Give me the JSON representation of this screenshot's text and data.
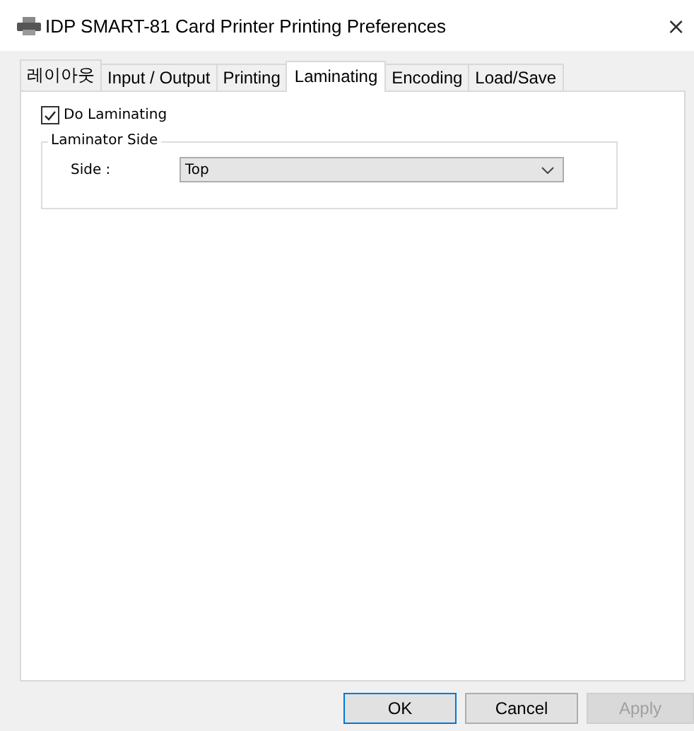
{
  "window": {
    "title": "IDP SMART-81 Card Printer Printing Preferences",
    "close": "×"
  },
  "tabs": [
    {
      "label": "레이아웃",
      "selected": false
    },
    {
      "label": "Input / Output",
      "selected": false
    },
    {
      "label": "Printing",
      "selected": false
    },
    {
      "label": "Laminating",
      "selected": true
    },
    {
      "label": "Encoding",
      "selected": false
    },
    {
      "label": "Load/Save",
      "selected": false
    }
  ],
  "do_laminating": {
    "label": "Do Laminating",
    "checked": true
  },
  "laminator_side": {
    "title": "Laminator Side",
    "label": "Side :",
    "value": "Top"
  },
  "buttons": [
    {
      "label": "OK",
      "default": true,
      "disabled": false
    },
    {
      "label": "Cancel",
      "default": false,
      "disabled": false
    },
    {
      "label": "Apply",
      "default": false,
      "disabled": true
    }
  ]
}
